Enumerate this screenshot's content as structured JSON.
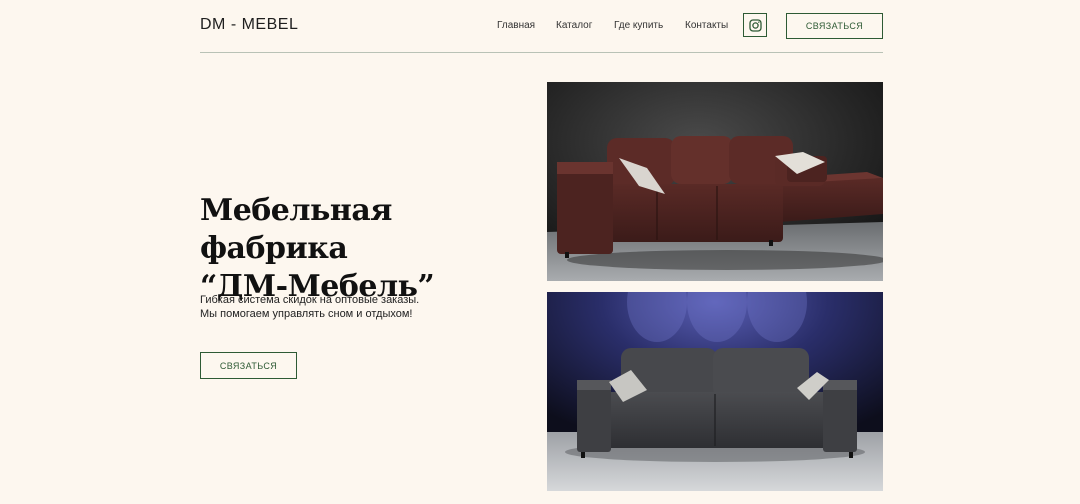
{
  "header": {
    "logo": "DM - MEBEL",
    "nav": [
      "Главная",
      "Каталог",
      "Где купить",
      "Контакты"
    ],
    "instagram_icon": "instagram-icon",
    "contact_button": "СВЯЗАТЬСЯ"
  },
  "hero": {
    "title_line1": "Мебельная фабрика",
    "title_line2": "“ДМ-Мебель”",
    "subtitle_line1": "Гибкая система скидок на оптовые заказы.",
    "subtitle_line2": "Мы помогаем управлять сном и отдыхом!",
    "button": "СВЯЗАТЬСЯ"
  },
  "colors": {
    "background": "#fdf7ef",
    "accent": "#2e5a34"
  },
  "images": [
    {
      "name": "brown-corner-sofa-photo"
    },
    {
      "name": "grey-sofa-photo"
    }
  ]
}
